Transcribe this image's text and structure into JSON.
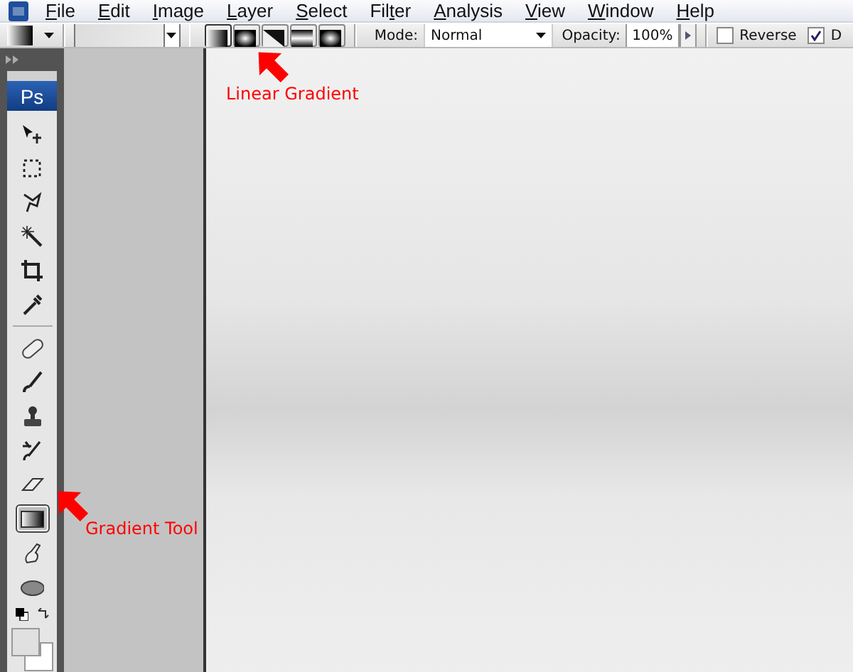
{
  "menu_bar": {
    "items": [
      {
        "key": "F",
        "post": "ile"
      },
      {
        "key": "E",
        "post": "dit"
      },
      {
        "key": "I",
        "post": "mage"
      },
      {
        "key": "L",
        "post": "ayer"
      },
      {
        "key": "S",
        "post": "elect"
      },
      {
        "pre": "Fil",
        "key": "t",
        "post": "er"
      },
      {
        "key": "A",
        "post": "nalysis"
      },
      {
        "key": "V",
        "post": "iew"
      },
      {
        "key": "W",
        "post": "indow"
      },
      {
        "key": "H",
        "post": "elp"
      }
    ]
  },
  "options_bar": {
    "gradient_types": [
      {
        "kind": "linear",
        "selected": true
      },
      {
        "kind": "radial",
        "selected": false
      },
      {
        "kind": "angle",
        "selected": false
      },
      {
        "kind": "reflected",
        "selected": false
      },
      {
        "kind": "diamond",
        "selected": false
      }
    ],
    "mode": {
      "label": "Mode:",
      "value": "Normal"
    },
    "opacity": {
      "label": "Opacity:",
      "value": "100%"
    },
    "checkboxes": [
      {
        "label": "Reverse",
        "checked": false
      },
      {
        "label": "D",
        "checked": true
      }
    ]
  },
  "toolbox": {
    "logo": "Ps",
    "tools": [
      {
        "kind": "move",
        "selected": false
      },
      {
        "kind": "marquee",
        "selected": false
      },
      {
        "kind": "lasso",
        "selected": false
      },
      {
        "kind": "wand",
        "selected": false
      },
      {
        "kind": "crop",
        "selected": false
      },
      {
        "kind": "eyedropper",
        "selected": false
      },
      {
        "kind": "divider"
      },
      {
        "kind": "heal",
        "selected": false
      },
      {
        "kind": "brush",
        "selected": false
      },
      {
        "kind": "stamp",
        "selected": false
      },
      {
        "kind": "history",
        "selected": false
      },
      {
        "kind": "eraser",
        "selected": false
      },
      {
        "kind": "gradient",
        "selected": true
      },
      {
        "kind": "smudge",
        "selected": false
      },
      {
        "kind": "dodge",
        "selected": false
      }
    ],
    "swatches": [
      {
        "color": "#e0e0e0"
      },
      {
        "color": "#ffffff"
      }
    ]
  },
  "annotations": [
    {
      "text": "Linear Gradient"
    },
    {
      "text": "Gradient Tool"
    }
  ]
}
